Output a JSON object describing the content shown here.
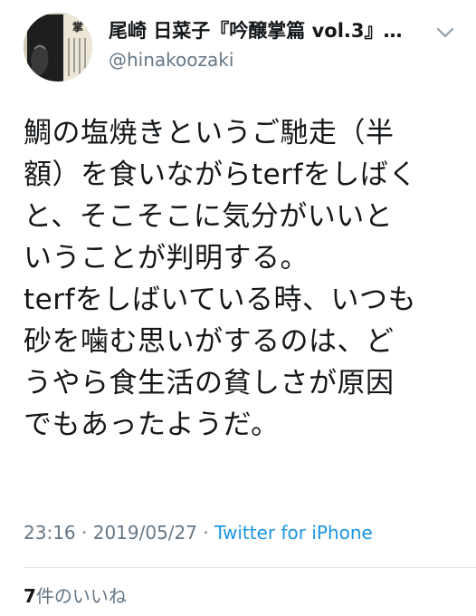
{
  "tweet": {
    "display_name": "尾崎 日菜子『吟醸掌篇 vol.3』…",
    "handle": "@hinakoozaki",
    "avatar": {
      "icon": "book-cover-avatar",
      "title_glyph": "掌"
    },
    "menu_icon": "chevron-down-icon",
    "text_lines": [
      "鯛の塩焼きというご馳走（半",
      "額）を食いながらterfをしばく",
      "と、そこそこに気分がいいと",
      "いうことが判明する。",
      "terfをしばいている時、いつも",
      "砂を噛む思いがするのは、ど",
      "うやら食生活の貧しさが原因",
      "でもあったようだ。"
    ],
    "time": "23:16",
    "separator": "·",
    "date": "2019/05/27",
    "source": "Twitter for iPhone",
    "likes_count": "7",
    "likes_label": "件のいいね"
  },
  "colors": {
    "text": "#14171a",
    "secondary": "#657786",
    "link": "#1b95e0",
    "divider": "#e1e8ed"
  }
}
